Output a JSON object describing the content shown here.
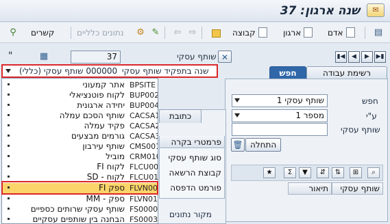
{
  "window": {
    "title": "שנה ארגון: 37"
  },
  "toolbar": {
    "person_label": "אדם",
    "org_label": "ארגון",
    "group_label": "קבוצה",
    "general_data_label": "נתונים כלליים",
    "relations_label": "קשרים"
  },
  "header": {
    "business_partner_label": "שותף עסקי",
    "business_partner_value": "37",
    "change_in_role_label": "שנה בתפקיד שותף עסקי",
    "role_value": "000000 שותף עסקי (כללי)",
    "quote_mark": "\""
  },
  "tabs": {
    "search": "חפש",
    "worklist": "רשימת עבודה",
    "address": "כתובת",
    "control": "פרמטרי בקרה"
  },
  "search_panel": {
    "find_label": "חפש",
    "find_value": "1 שותף עסקי",
    "by_label": "ע\"י",
    "by_value": "1 מספר",
    "bp_label": "שותף עסקי",
    "bp_value": "",
    "start_button": "התחלה"
  },
  "grid": {
    "col_bp": "שותף עסקי",
    "col_desc": "תיאור"
  },
  "mid_group": {
    "title": "פרמטרי בקרה",
    "row1": "סוג שותף עסקי",
    "row2": "קבוצת הרשאה",
    "row3": "פורמט הדפסה",
    "footer": "מקור נתונים"
  },
  "role_list": [
    {
      "code": "BPSITE",
      "desc": "אתר קמעוני"
    },
    {
      "code": "BUP002",
      "desc": "לקוח פוטנציאלי"
    },
    {
      "code": "BUP004",
      "desc": "יחידה ארגונית"
    },
    {
      "code": "CACSA1",
      "desc": "שותף הסכם עמלה"
    },
    {
      "code": "CACSA2",
      "desc": "פקיד עמלה"
    },
    {
      "code": "CACSA3",
      "desc": "גורמים מבצעים"
    },
    {
      "code": "CMS001",
      "desc": "שותף עירבון"
    },
    {
      "code": "CRM010",
      "desc": "מוביל"
    },
    {
      "code": "FLCU00",
      "desc": "לקוח FI"
    },
    {
      "code": "FLCU01",
      "desc": "לקוח - SD"
    },
    {
      "code": "FLVN00",
      "desc": "ספק FI"
    },
    {
      "code": "FLVN01",
      "desc": "ספק - MM"
    },
    {
      "code": "FS0000",
      "desc": "שותף עסקי שרותים כספיים"
    },
    {
      "code": "FS0003",
      "desc": "הבחנה בין שותפים עסקיים"
    }
  ],
  "colors": {
    "selected_row": "#fbd46a",
    "highlight_frame": "#d9262b",
    "active_tab": "#2f67a8"
  }
}
